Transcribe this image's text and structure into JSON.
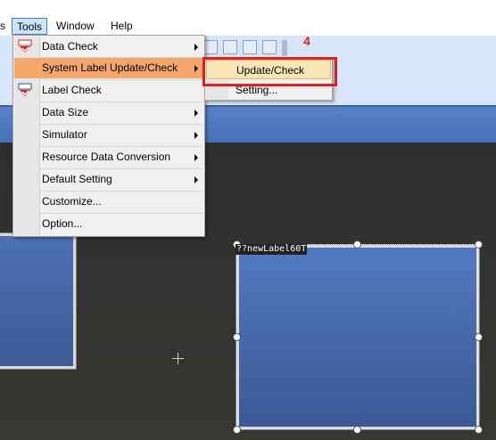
{
  "menubar": {
    "items": [
      {
        "label": "s"
      },
      {
        "label": "Tools"
      },
      {
        "label": "Window"
      },
      {
        "label": "Help"
      }
    ]
  },
  "tools_menu": {
    "items": [
      {
        "label": "Data Check",
        "has_submenu": true,
        "icon": "data-check-icon"
      },
      {
        "label": "System Label Update/Check",
        "has_submenu": true,
        "highlighted": true
      },
      {
        "label": "Label Check",
        "has_submenu": false,
        "icon": "label-check-icon"
      },
      {
        "label": "Data Size",
        "has_submenu": true
      },
      {
        "label": "Simulator",
        "has_submenu": true
      },
      {
        "label": "Resource Data Conversion",
        "has_submenu": true
      },
      {
        "label": "Default Setting",
        "has_submenu": true
      },
      {
        "label": "Customize...",
        "has_submenu": false
      },
      {
        "label": "Option...",
        "has_submenu": false
      }
    ]
  },
  "submenu": {
    "items": [
      {
        "label": "Update/Check",
        "highlighted": true
      },
      {
        "label": "Setting..."
      }
    ]
  },
  "annotation": {
    "step_number": "4"
  },
  "canvas": {
    "selected_object_label": "??newLabel60T"
  },
  "colors": {
    "highlight": "#f5a66b",
    "annotation": "#e02020",
    "panel": "#4a6db0"
  }
}
